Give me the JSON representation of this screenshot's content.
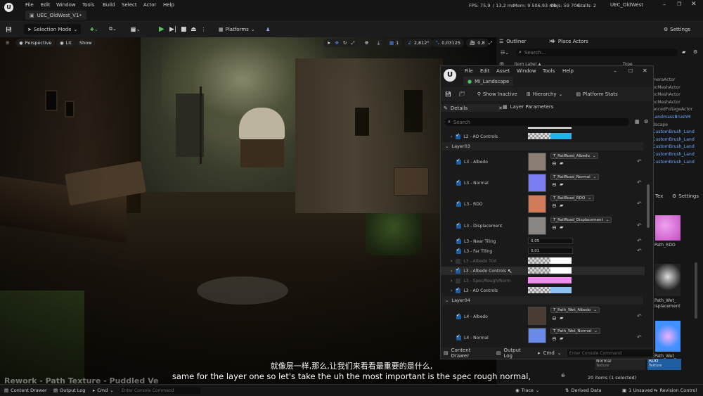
{
  "menubar": {
    "tab_title": "UEC_OldWest_V1•",
    "menu": [
      "File",
      "Edit",
      "Window",
      "Tools",
      "Build",
      "Select",
      "Actor",
      "Help"
    ],
    "stats": {
      "fps": "FPS: 75,9",
      "ms": "/ 13,2 ms",
      "mem": "Mem: 9 506,93 mb",
      "objs": "Objs: 59 706",
      "stalls": "Stalls: 2"
    },
    "project_name": "UEC_OldWest"
  },
  "toolbar": {
    "selection_mode": "Selection Mode",
    "platforms": "Platforms",
    "settings": "Settings"
  },
  "viewport": {
    "perspective": "Perspective",
    "lit": "Lit",
    "show": "Show",
    "grid_value": "1",
    "rotate_value": "2,812°",
    "scale_value": "0,03125",
    "speed_value": "0,8"
  },
  "outliner": {
    "title": "Outliner",
    "place_actors": "Place Actors",
    "search_placeholder": "Search...",
    "col_label": "Item Label ▲",
    "col_type": "Type",
    "rows": [
      {
        "label": "meraActor",
        "link": false
      },
      {
        "label": "ocMeshActor",
        "link": false
      },
      {
        "label": "ocMeshActor",
        "link": false
      },
      {
        "label": "ocMeshActor",
        "link": false
      },
      {
        "label": "ancedFoliageActor",
        "link": false
      },
      {
        "label": "LandmassBrushM",
        "link": true
      },
      {
        "label": "dscape",
        "link": false
      },
      {
        "label": "CustomBrush_Land",
        "link": true
      },
      {
        "label": "CustomBrush_Land",
        "link": true
      },
      {
        "label": "CustomBrush_Land",
        "link": true
      },
      {
        "label": "CustomBrush_Land",
        "link": true
      },
      {
        "label": "CustomBrush_Land",
        "link": true
      }
    ],
    "right_tab": "Tex",
    "right_settings": "Settings",
    "thumbs": [
      {
        "label": "Path_RDO",
        "sub": ""
      },
      {
        "label": "Path_Wet_",
        "sub": "isplacement"
      },
      {
        "label": "Path_Wet_",
        "sub": "RDO"
      }
    ],
    "item_normal": "Normal",
    "item_normal_sub": "Texture",
    "item_rdo": "RDO",
    "item_rdo_sub": "Texture",
    "items_count": "20 items (1 selected)"
  },
  "matwin": {
    "menu": [
      "File",
      "Edit",
      "Asset",
      "Window",
      "Tools",
      "Help"
    ],
    "tab_title": "MI_Landscape",
    "show_inactive": "Show Inactive",
    "hierarchy": "Hierarchy",
    "platform_stats": "Platform Stats",
    "tab_details": "Details",
    "tab_layer_params": "Layer Parameters",
    "search_placeholder": "Search",
    "l2_ao": "L2 - AO Controls",
    "layer03": "Layer03",
    "l3_albedo": "L3 - Albedo",
    "l3_albedo_tex": "T_RailRoad_Albedo",
    "l3_normal": "L3 - Normal",
    "l3_normal_tex": "T_RailRoad_Normal",
    "l3_rdo": "L3 - RDO",
    "l3_rdo_tex": "T_RailRoad_RDO",
    "l3_disp": "L3 - Displacement",
    "l3_disp_tex": "T_RailRoad_Displacement",
    "l3_near": "L3 - Near Tiling",
    "l3_near_val": "0,05",
    "l3_far": "L3 - Far Tiling",
    "l3_far_val": "0,01",
    "l3_albedo_tint": "L3 - Albedo Tint",
    "l3_albedo_ctrl": "L3 - Albedo Controls",
    "l3_spec": "L3 - Spec/Rough/Norm",
    "l3_ao": "L3 - AO Controls",
    "layer04": "Layer04",
    "l4_albedo": "L4 - Albedo",
    "l4_albedo_tex": "T_Path_Wet_Albedo",
    "l4_normal": "L4 - Normal",
    "l4_normal_tex": "T_Path_Wet_Normal",
    "content_drawer": "Content Drawer",
    "output_log": "Output Log",
    "cmd": "Cmd",
    "console_placeholder": "Enter Console Command"
  },
  "subtitles": {
    "chinese": "就像层一样,那么,让我们来看看最重要的是什么,",
    "english": "same for the layer one so let's take the uh the most important is the spec rough normal,",
    "watermark": "Rework - Path Texture - Puddled Ve"
  },
  "status": {
    "content_drawer": "Content Drawer",
    "output_log": "Output Log",
    "cmd": "Cmd",
    "console_placeholder": "Enter Console Command",
    "trace": "Trace",
    "derived_data": "Derived Data",
    "unsaved": "1 Unsaved",
    "revision": "Revision Control"
  },
  "colors": {
    "accent": "#1e5da0",
    "cyan": "#19b6e6",
    "pink": "#f28bef",
    "lightblue": "#8ec2f2"
  }
}
